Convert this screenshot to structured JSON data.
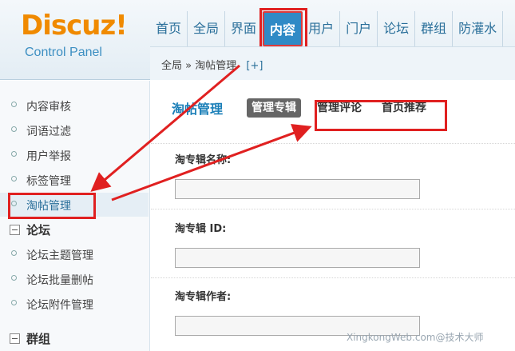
{
  "header": {
    "logo_main": "Discuz",
    "logo_bang": "!",
    "logo_sub": "Control Panel"
  },
  "nav": {
    "items": [
      {
        "label": "首页"
      },
      {
        "label": "全局"
      },
      {
        "label": "界面"
      },
      {
        "label": "内容",
        "active": true
      },
      {
        "label": "用户"
      },
      {
        "label": "门户"
      },
      {
        "label": "论坛"
      },
      {
        "label": "群组"
      },
      {
        "label": "防灌水"
      }
    ]
  },
  "breadcrumb": {
    "root": "全局",
    "separator": "»",
    "current": "淘帖管理",
    "add": "[+]"
  },
  "sidebar": {
    "items": [
      {
        "label": "内容审核"
      },
      {
        "label": "词语过滤"
      },
      {
        "label": "用户举报"
      },
      {
        "label": "标签管理"
      },
      {
        "label": "淘帖管理",
        "active": true
      }
    ],
    "group_forum": "论坛",
    "forum_items": [
      {
        "label": "论坛主题管理"
      },
      {
        "label": "论坛批量删帖"
      },
      {
        "label": "论坛附件管理"
      }
    ],
    "group_group": "群组"
  },
  "main": {
    "title": "淘帖管理",
    "tabs": [
      {
        "label": "管理专辑",
        "active": true
      },
      {
        "label": "管理评论"
      },
      {
        "label": "首页推荐"
      }
    ],
    "fields": [
      {
        "label": "淘专辑名称:",
        "value": ""
      },
      {
        "label": "淘专辑 ID:",
        "value": ""
      },
      {
        "label": "淘专辑作者:",
        "value": ""
      }
    ]
  },
  "watermark": "XingkongWeb.com@技术大师",
  "colors": {
    "accent": "#2f8ac6",
    "logo": "#f08a00",
    "highlight": "#e02020"
  }
}
